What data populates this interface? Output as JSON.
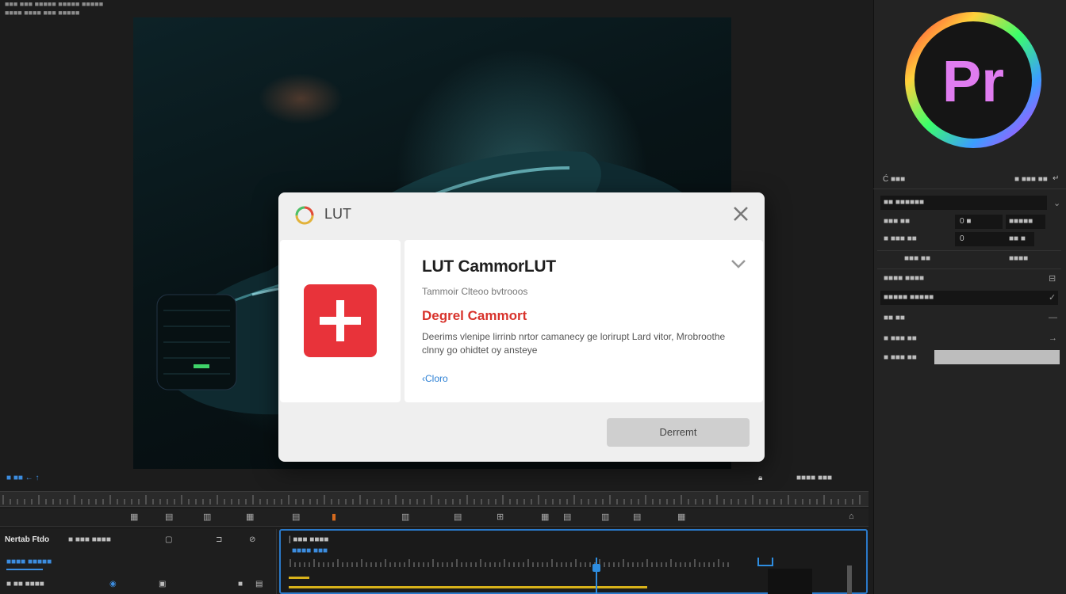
{
  "app": {
    "title_line1": "■■■ ■■■ ■■■■■ ■■■■■ ■■■■■",
    "title_line2": "■■■■ ■■■■ ■■■ ■■■■■",
    "logo_text": "Pr"
  },
  "effect_controls": {
    "header_left": "Ć ■■■",
    "header_right": "■ ■■■ ■■",
    "rows": [
      {
        "label": "■■ ■■■■■■"
      },
      {
        "label": "■■■ ■■",
        "value1": "0 ■",
        "value2": "■■■■■"
      },
      {
        "label": "■ ■■■ ■■",
        "value1": "0",
        "value2": "■■ ■"
      },
      {
        "label": "■■■ ■■",
        "value2": "■■■■"
      },
      {
        "label": "■■■■ ■■■■"
      },
      {
        "label": "■■■■■ ■■■■■"
      },
      {
        "label": "■■ ■■"
      },
      {
        "label": "■ ■■■ ■■"
      },
      {
        "label": "■ ■■■ ■■"
      }
    ]
  },
  "dialog": {
    "title": "LUT",
    "lut_name": "LUT CammorLUT",
    "subtitle": "Tammoir Clteoo bvtrooos",
    "error_title": "Degrel Cammort",
    "description": "Deerims vlenipe lirrinb nrtor camanecy ge lorirupt Lard vitor, Mrobroothe clnny go ohidtet oy ansteye",
    "link": "Cloro",
    "button": "Derremt"
  },
  "timeline": {
    "toolbar_left": "■ ■■ ← ↑",
    "toolbar_right": "■■■■ ■■■",
    "track_header": "Nertab Ftdo",
    "track_header2": "■ ■■■ ■■■■",
    "seq_label": "| ■■■ ■■■■",
    "seq_sub": "■■■■ ■■■",
    "left_row2": "■■■■ ■■■■■",
    "left_row3": "■ ■■ ■■■■"
  },
  "colors": {
    "accent": "#2a79c9",
    "error": "#d8332c",
    "red_icon": "#e8333a",
    "playhead": "#2e8de0",
    "audio_track": "#d8b21a"
  }
}
